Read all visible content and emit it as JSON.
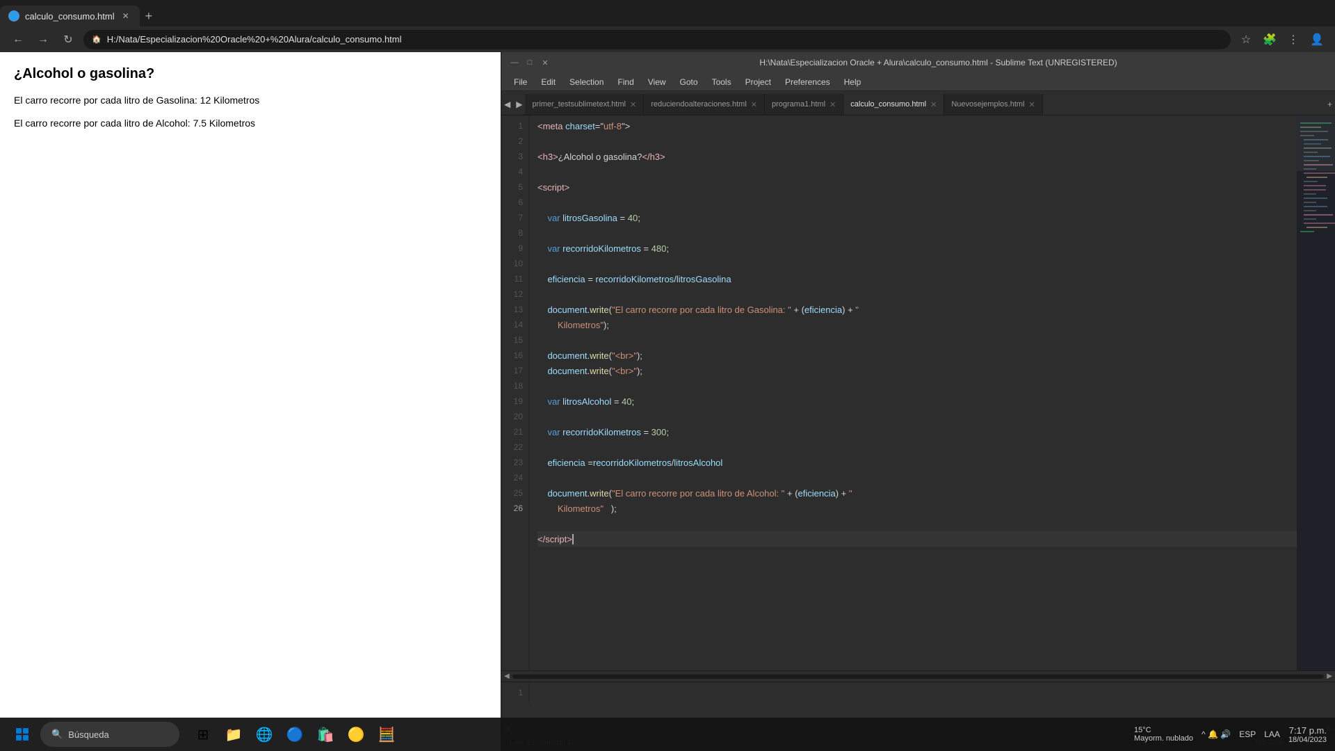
{
  "browser": {
    "tab_title": "calculo_consumo.html",
    "tab_favicon": "🌐",
    "address": "H:/Nata/Especializacion%20Oracle%20+%20Alura/calculo_consumo.html",
    "address_display": "H:/Nata/Especializacion%20Oracle%20+%20Alura/calculo_consumo.html"
  },
  "page": {
    "heading": "¿Alcohol o gasolina?",
    "line1": "El carro recorre por cada litro de Gasolina: 12 Kilometros",
    "line2": "El carro recorre por cada litro de Alcohol: 7.5 Kilometros"
  },
  "sublime": {
    "title": "H:\\Nata\\Especializacion Oracle + Alura\\calculo_consumo.html - Sublime Text (UNREGISTERED)",
    "menu": [
      "File",
      "Edit",
      "Selection",
      "Find",
      "View",
      "Goto",
      "Tools",
      "Project",
      "Preferences",
      "Help"
    ],
    "tabs": [
      {
        "label": "primer_testsublimetext.html",
        "active": false
      },
      {
        "label": "reduciendoalteraciones.html",
        "active": false
      },
      {
        "label": "programa1.html",
        "active": false
      },
      {
        "label": "calculo_consumo.html",
        "active": true
      },
      {
        "label": "Nuevosejemplos.html",
        "active": false
      }
    ],
    "bottom_status": "Line 26, Column 10",
    "bottom_tab": "Tab Size: 4",
    "bottom_syntax": "HTML"
  },
  "taskbar": {
    "search_placeholder": "Búsqueda",
    "weather_temp": "15°C",
    "weather_desc": "Mayorm. nublado",
    "time": "7:17 p.m.",
    "date": "18/04/2023",
    "lang": "ESP",
    "layout": "LAA"
  }
}
